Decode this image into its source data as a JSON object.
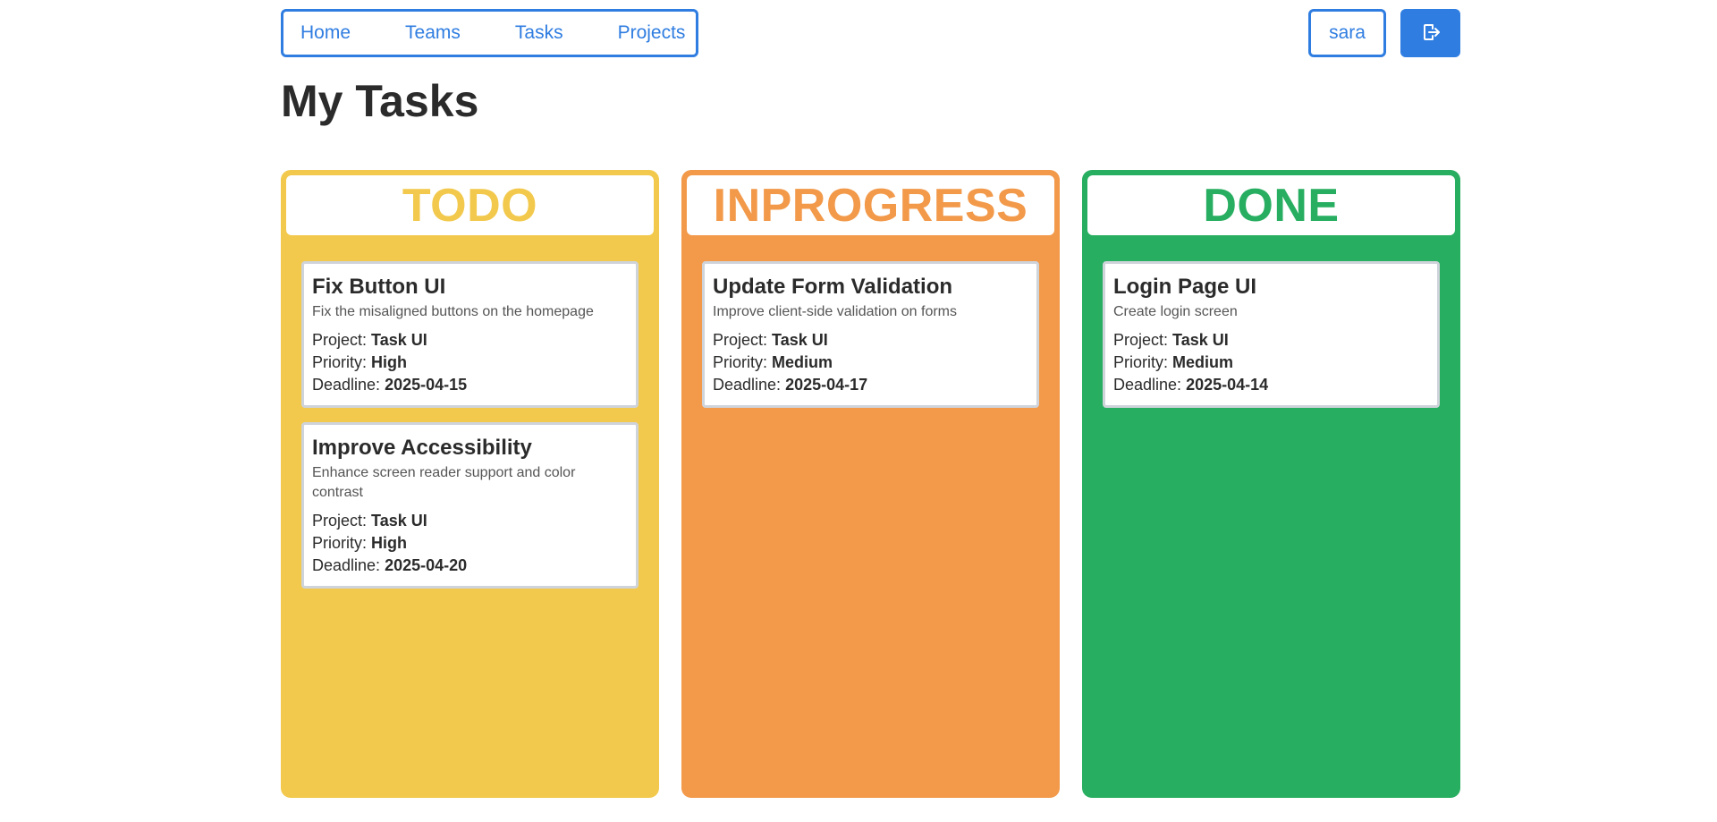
{
  "nav": {
    "links": [
      "Home",
      "Teams",
      "Tasks",
      "Projects"
    ]
  },
  "user": {
    "name": "sara",
    "logout_icon": "logout-icon"
  },
  "page": {
    "title": "My Tasks"
  },
  "labels": {
    "project": "Project:",
    "priority": "Priority:",
    "deadline": "Deadline:"
  },
  "columns": [
    {
      "title": "TODO",
      "color": "#f2c94c",
      "cards": [
        {
          "title": "Fix Button UI",
          "description": "Fix the misaligned buttons on the homepage",
          "project": "Task UI",
          "priority": "High",
          "deadline": "2025-04-15"
        },
        {
          "title": "Improve Accessibility",
          "description": "Enhance screen reader support and color contrast",
          "project": "Task UI",
          "priority": "High",
          "deadline": "2025-04-20"
        }
      ]
    },
    {
      "title": "INPROGRESS",
      "color": "#f2994a",
      "cards": [
        {
          "title": "Update Form Validation",
          "description": "Improve client-side validation on forms",
          "project": "Task UI",
          "priority": "Medium",
          "deadline": "2025-04-17"
        }
      ]
    },
    {
      "title": "DONE",
      "color": "#27ae60",
      "cards": [
        {
          "title": "Login Page UI",
          "description": "Create login screen",
          "project": "Task UI",
          "priority": "Medium",
          "deadline": "2025-04-14"
        }
      ]
    }
  ],
  "theme": {
    "accent": "#2f7de1"
  }
}
